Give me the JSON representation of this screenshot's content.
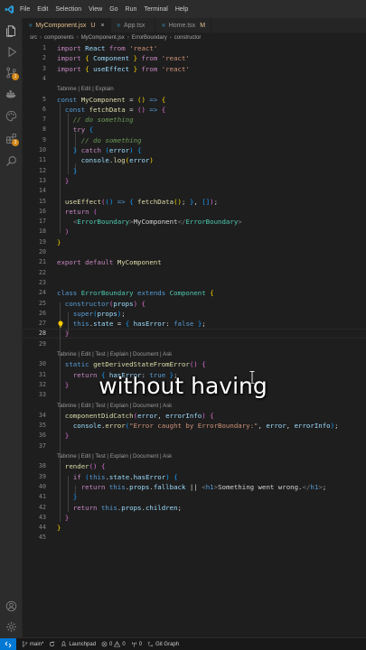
{
  "titlebar": {
    "menu": [
      "File",
      "Edit",
      "Selection",
      "View",
      "Go",
      "Run",
      "Terminal",
      "Help"
    ]
  },
  "tabs": [
    {
      "label": "MyComponent.jsx",
      "modified": "U",
      "active": true,
      "icon": "react-icon"
    },
    {
      "label": "App.tsx",
      "modified": "",
      "active": false,
      "icon": "react-icon"
    },
    {
      "label": "Home.tsx",
      "modified": "M",
      "active": false,
      "icon": "react-icon"
    }
  ],
  "breadcrumb": [
    "src",
    "components",
    "MyComponent.jsx",
    "ErrorBoundary",
    "constructor"
  ],
  "lens": {
    "first": "Tabnine | Edit | Explain",
    "full": "Tabnine | Edit | Test | Explain | Document | Ask"
  },
  "line_numbers": [
    "1",
    "2",
    "3",
    "4",
    "5",
    "6",
    "7",
    "8",
    "9",
    "10",
    "11",
    "12",
    "13",
    "14",
    "15",
    "16",
    "17",
    "18",
    "19",
    "20",
    "21",
    "22",
    "23",
    "24",
    "25",
    "26",
    "27",
    "28",
    "29",
    "30",
    "31",
    "32",
    "33",
    "34",
    "35",
    "36",
    "37",
    "38",
    "39",
    "40",
    "41",
    "42",
    "43",
    "44",
    "45"
  ],
  "caption": "without having",
  "statusbar": {
    "branch": "main*",
    "launchpad": "Launchpad",
    "errors": "0",
    "warnings": "0",
    "ports": "0",
    "git_graph": "Git Graph"
  }
}
